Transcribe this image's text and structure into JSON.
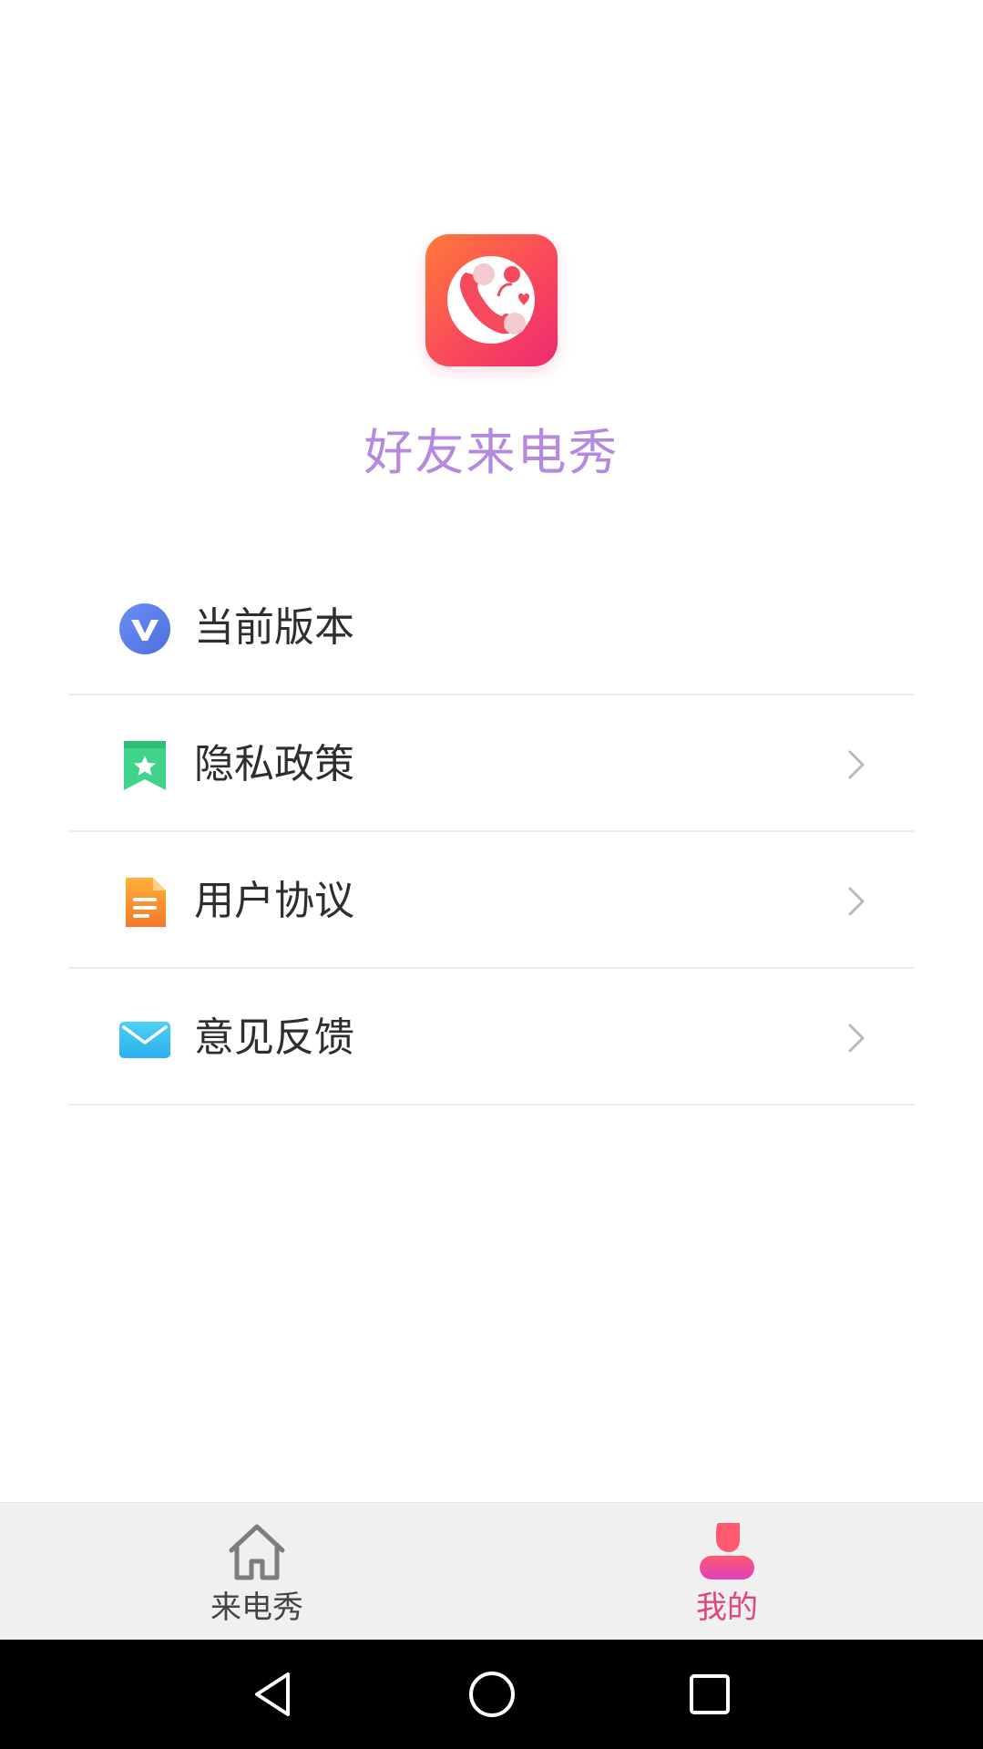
{
  "app": {
    "name": "好友来电秀",
    "icon": "phone-heart-app-icon",
    "title_color": "#b489e0"
  },
  "menu": {
    "items": [
      {
        "label": "当前版本",
        "icon": "version-v-icon",
        "chevron": false
      },
      {
        "label": "隐私政策",
        "icon": "bookmark-star-icon",
        "chevron": true
      },
      {
        "label": "用户协议",
        "icon": "document-icon",
        "chevron": true
      },
      {
        "label": "意见反馈",
        "icon": "mail-icon",
        "chevron": true
      }
    ]
  },
  "tab_bar": {
    "tabs": [
      {
        "label": "来电秀",
        "icon": "home-icon",
        "active": false
      },
      {
        "label": "我的",
        "icon": "profile-icon",
        "active": true
      }
    ],
    "active_color": "#e0457f"
  },
  "nav_bar": {
    "buttons": [
      "back-icon",
      "home-circle-icon",
      "recent-apps-icon"
    ]
  }
}
